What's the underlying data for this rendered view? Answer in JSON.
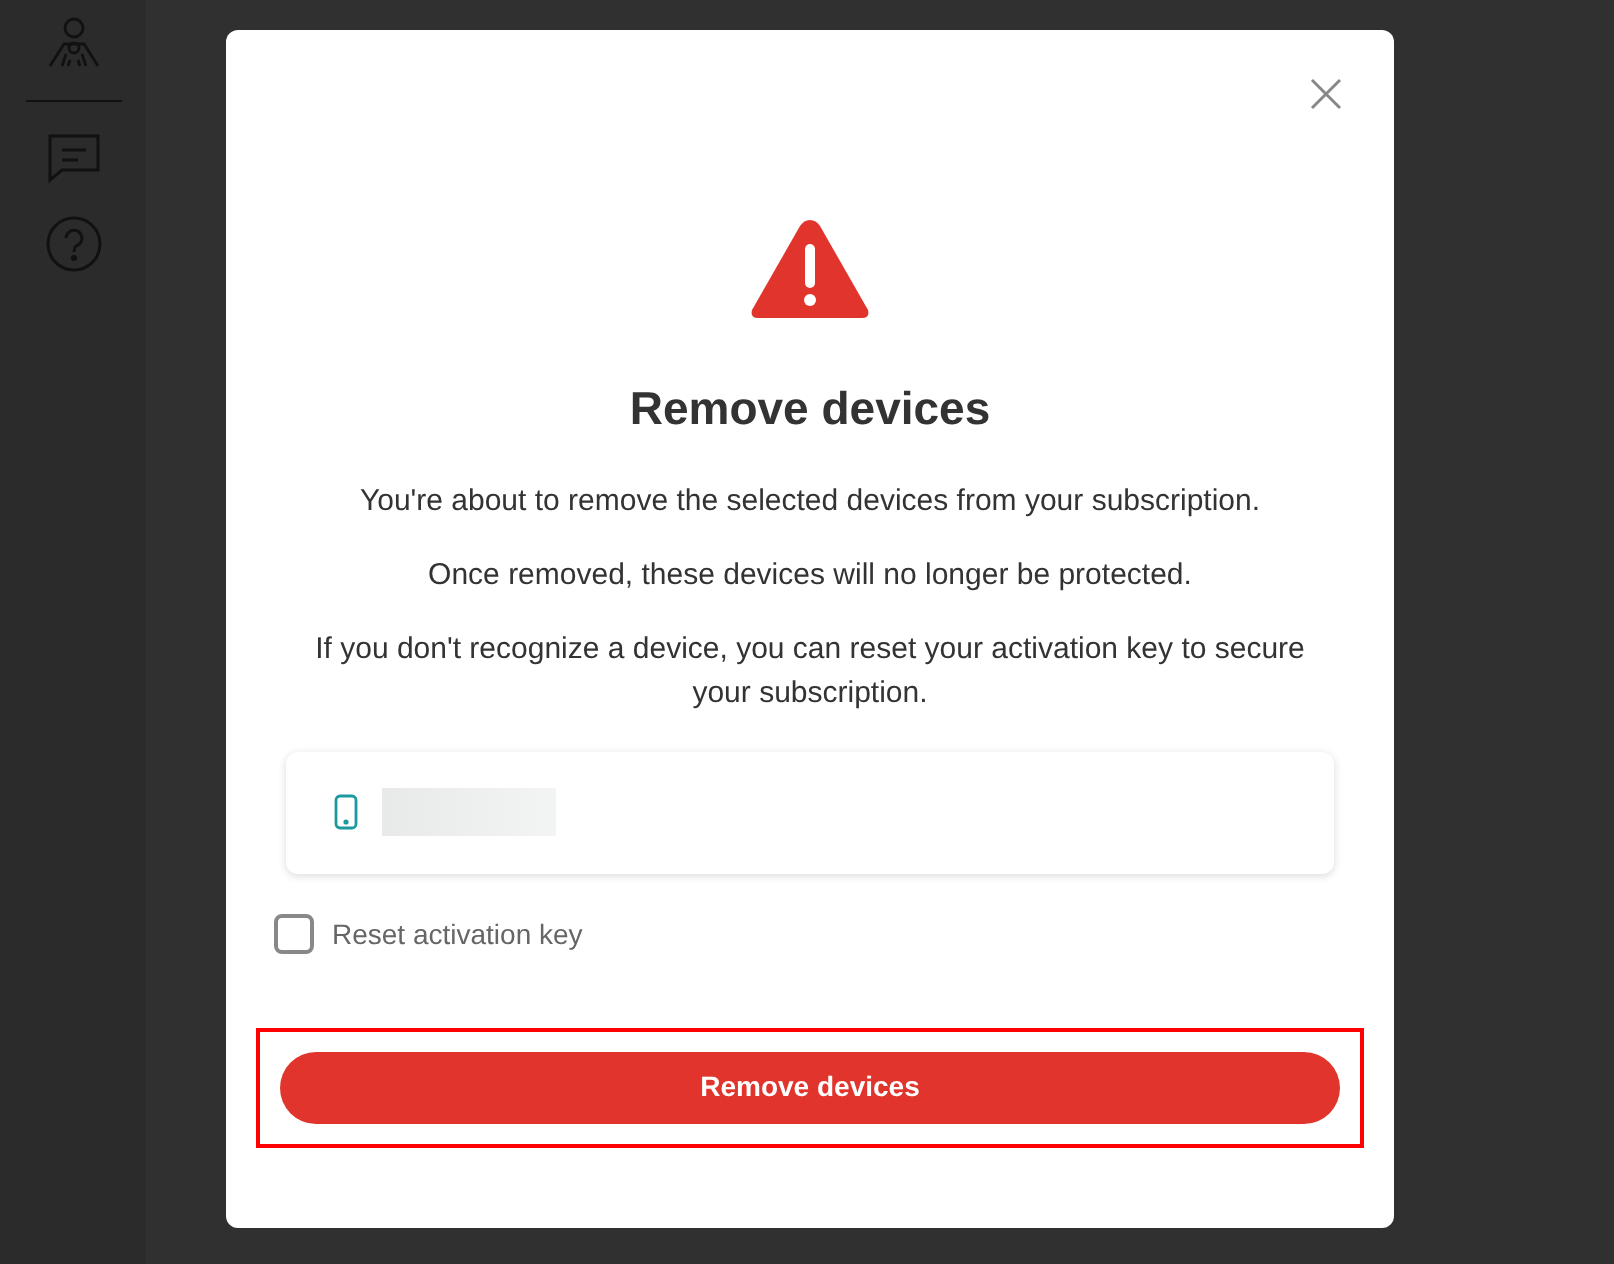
{
  "dialog": {
    "title": "Remove devices",
    "paragraphs": [
      "You're about to remove the selected devices from your subscription.",
      "Once removed, these devices will no longer be protected.",
      "If you don't recognize a device, you can reset your activation key to secure your subscription."
    ],
    "devices": [
      {
        "kind": "phone"
      }
    ],
    "checkbox": {
      "label": "Reset activation key",
      "checked": false
    },
    "button": {
      "label": "Remove devices",
      "highlighted": true
    }
  }
}
